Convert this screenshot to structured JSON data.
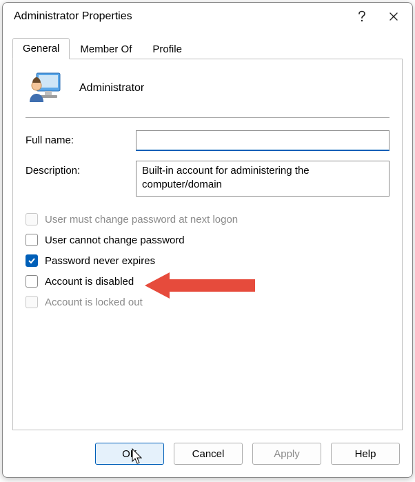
{
  "window": {
    "title": "Administrator Properties"
  },
  "tabs": {
    "general": "General",
    "memberof": "Member Of",
    "profile": "Profile",
    "active": "general"
  },
  "user": {
    "name": "Administrator"
  },
  "fields": {
    "fullname_label": "Full name:",
    "fullname_value": "",
    "description_label": "Description:",
    "description_value": "Built-in account for administering the computer/domain"
  },
  "checkboxes": {
    "must_change": {
      "label": "User must change password at next logon",
      "checked": false,
      "enabled": false
    },
    "cannot_change": {
      "label": "User cannot change password",
      "checked": false,
      "enabled": true
    },
    "never_expires": {
      "label": "Password never expires",
      "checked": true,
      "enabled": true
    },
    "disabled": {
      "label": "Account is disabled",
      "checked": false,
      "enabled": true
    },
    "locked": {
      "label": "Account is locked out",
      "checked": false,
      "enabled": false
    }
  },
  "buttons": {
    "ok": "OK",
    "cancel": "Cancel",
    "apply": "Apply",
    "help": "Help"
  },
  "annotation": {
    "points_to": "checkbox-account-disabled"
  }
}
